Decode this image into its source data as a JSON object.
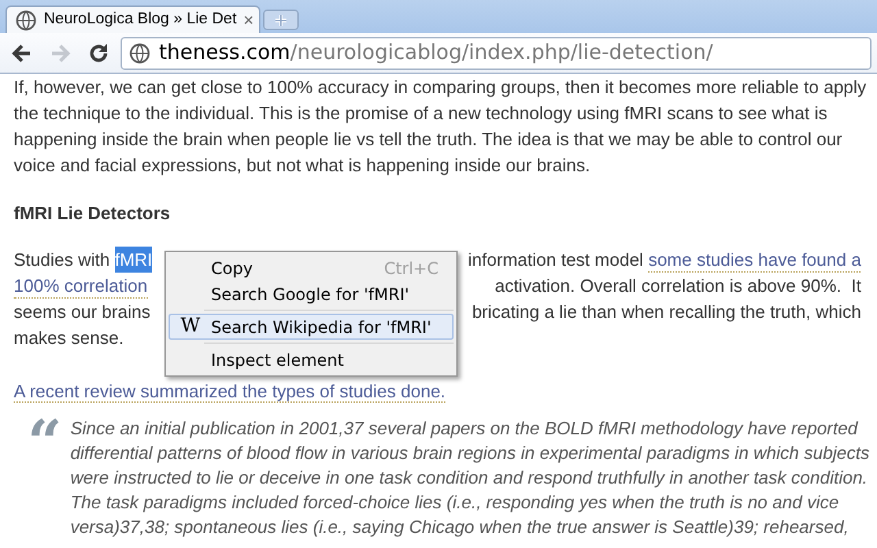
{
  "tabs": [
    {
      "title": "NeuroLogica Blog » Lie Det",
      "selected": true,
      "close": "×"
    }
  ],
  "toolbar": {
    "back_disabled": false,
    "forward_disabled": true,
    "url_host": "theness.com",
    "url_path": "/neurologicablog/index.php/lie-detection/"
  },
  "article": {
    "intro": "If, however, we can get close to 100% accuracy in comparing groups, then it becomes more reliable to apply the technique to the individual. This is the promise of a new technology using fMRI scans to see what is happening inside the brain when people lie vs tell the truth. The idea is that we may be able to control our voice and facial expressions, but not what is happening inside our brains.",
    "heading": "fMRI Lie Detectors",
    "covered_lines": [
      {
        "left": [
          {
            "text": "Studies with ",
            "kind": "plain"
          },
          {
            "text": "fMRI",
            "kind": "selected"
          }
        ],
        "right": [
          {
            "text": "information test model ",
            "kind": "plain"
          },
          {
            "text": "some studies have found a",
            "kind": "link"
          }
        ]
      },
      {
        "left": [
          {
            "text": "100% correlation",
            "kind": "link"
          }
        ],
        "right": [
          {
            "text": "activation. Overall correlation is above 90%.  It",
            "kind": "plain"
          }
        ]
      },
      {
        "left": [
          {
            "text": "seems our brains",
            "kind": "plain"
          }
        ],
        "right": [
          {
            "text": "bricating a lie than when recalling the truth, which",
            "kind": "plain"
          }
        ]
      },
      {
        "left": [
          {
            "text": "makes sense.",
            "kind": "plain"
          }
        ]
      }
    ],
    "review_link": "A recent review summarized the types of studies done.",
    "quote_mark": "“",
    "quote_lines": [
      "Since an initial publication in 2001,37 several papers on the BOLD fMRI methodology have reported",
      "differential patterns of blood flow in various brain regions in experimental paradigms in which subjects",
      "were instructed to lie or deceive in one task condition and respond truthfully in another task condition.",
      "The task paradigms included forced-choice lies (i.e., responding yes when the truth is no and vice",
      "versa)37,38; spontaneous lies (i.e., saying Chicago when the true answer is Seattle)39; rehearsed,"
    ]
  },
  "context_menu": [
    {
      "kind": "item",
      "label": "Copy",
      "shortcut": "Ctrl+C",
      "selected": false
    },
    {
      "kind": "item",
      "label": "Search Google for 'fMRI'",
      "selected": false
    },
    {
      "kind": "separator"
    },
    {
      "kind": "item",
      "label": "Search Wikipedia for 'fMRI'",
      "icon": "W",
      "selected": true
    },
    {
      "kind": "separator"
    },
    {
      "kind": "item",
      "label": "Inspect element",
      "selected": false
    }
  ]
}
